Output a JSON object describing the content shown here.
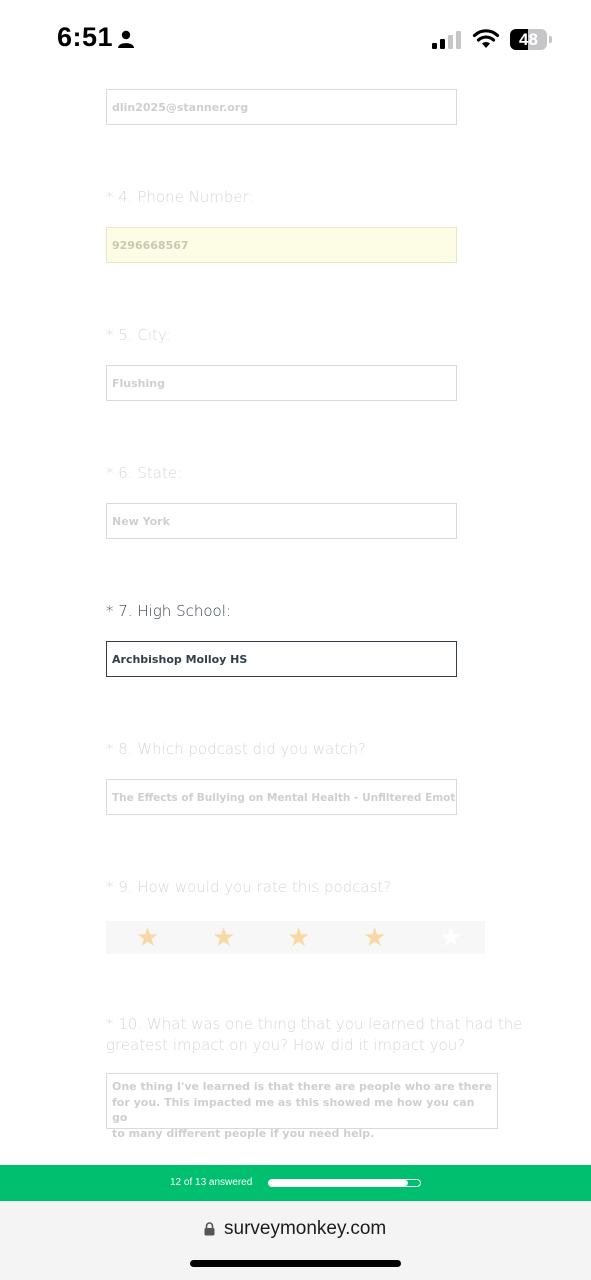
{
  "status_bar": {
    "time": "6:51",
    "battery_level": "48",
    "battery_fraction": 0.48
  },
  "questions": {
    "q3": {
      "value": "dlin2025@stanner.org"
    },
    "q4": {
      "title": "* 4. Phone Number:",
      "value": "9296668567"
    },
    "q5": {
      "title": "* 5. City:",
      "value": "Flushing"
    },
    "q6": {
      "title": "* 6. State:",
      "value": "New York"
    },
    "q7": {
      "title": "* 7. High School:",
      "value": "Archbishop Molloy HS"
    },
    "q8": {
      "title": "* 8. Which podcast did you watch?",
      "value": "The Effects of Bullying on Mental Health - Unfiltered Emotions"
    },
    "q9": {
      "title": "* 9. How would you rate this podcast?",
      "rating": 4,
      "max_rating": 5,
      "star_color": "#f9c56e",
      "empty_star_color": "#ffffff"
    },
    "q10": {
      "title_line1": "* 10. What was one thing that you learned that had the",
      "title_line2": "greatest impact on you? How did it impact you?",
      "answer_line1": "One thing I've learned is that there are people who are there",
      "answer_line2": "for you. This impacted me as this showed me how you can go",
      "answer_line3": "to many different people if you need help."
    }
  },
  "progress": {
    "label": "12 of 13 answered",
    "answered": 12,
    "total": 13,
    "color": "#00bf6f"
  },
  "browser": {
    "url": "surveymonkey.com"
  }
}
